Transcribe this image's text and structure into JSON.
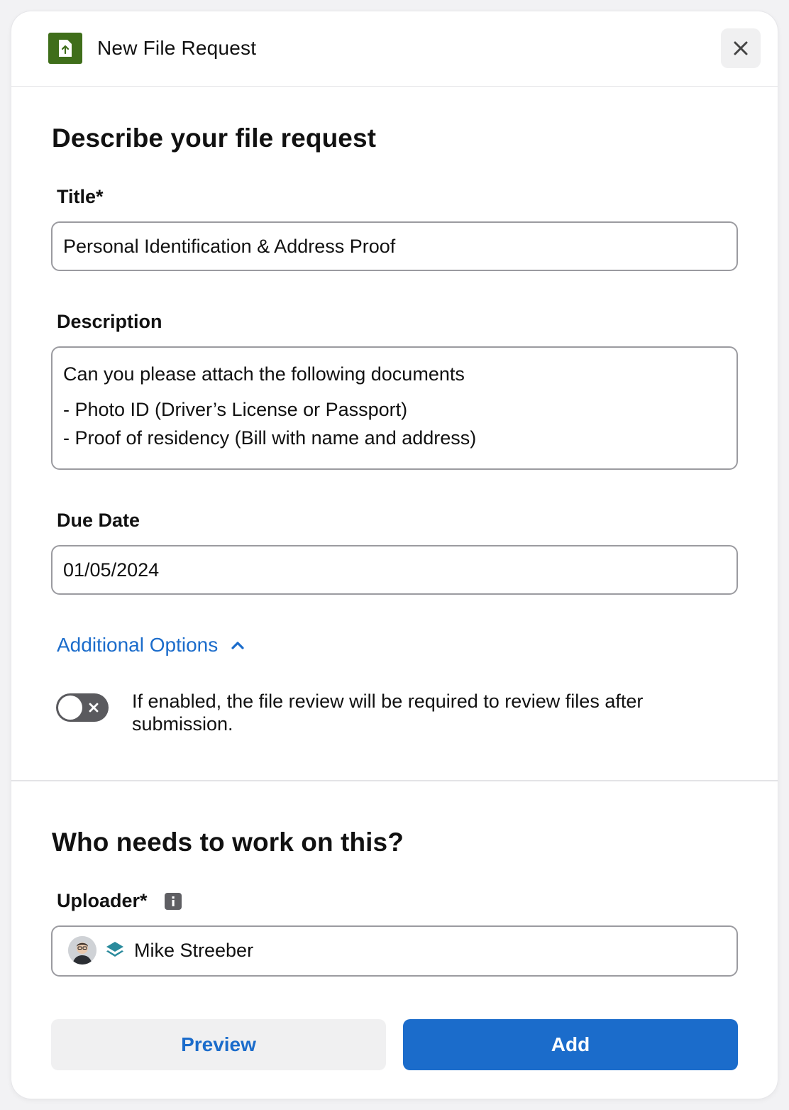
{
  "header": {
    "title": "New File Request",
    "app_icon": "file-upload-icon",
    "close_icon": "close-icon"
  },
  "details": {
    "heading": "Describe your file request",
    "title_label": "Title*",
    "title_value": "Personal Identification & Address Proof",
    "description_label": "Description",
    "description_lines": [
      "Can you please attach the following documents",
      "- Photo ID (Driver’s License or Passport)",
      "- Proof of residency (Bill with name and address)"
    ],
    "due_date_label": "Due Date",
    "due_date_value": "01/05/2024",
    "additional_options_label": "Additional Options",
    "review_toggle_enabled": false,
    "review_toggle_text": "If enabled, the file review will be required to review files after submission."
  },
  "assignment": {
    "heading": "Who needs to work on this?",
    "uploader_label": "Uploader*",
    "uploader_name": "Mike Streeber"
  },
  "actions": {
    "preview_label": "Preview",
    "add_label": "Add"
  },
  "colors": {
    "accent": "#1b6ccb",
    "app_icon": "#3f6e1a",
    "toggle_off": "#5a5a5e",
    "stack_icon": "#2a8a9c"
  }
}
